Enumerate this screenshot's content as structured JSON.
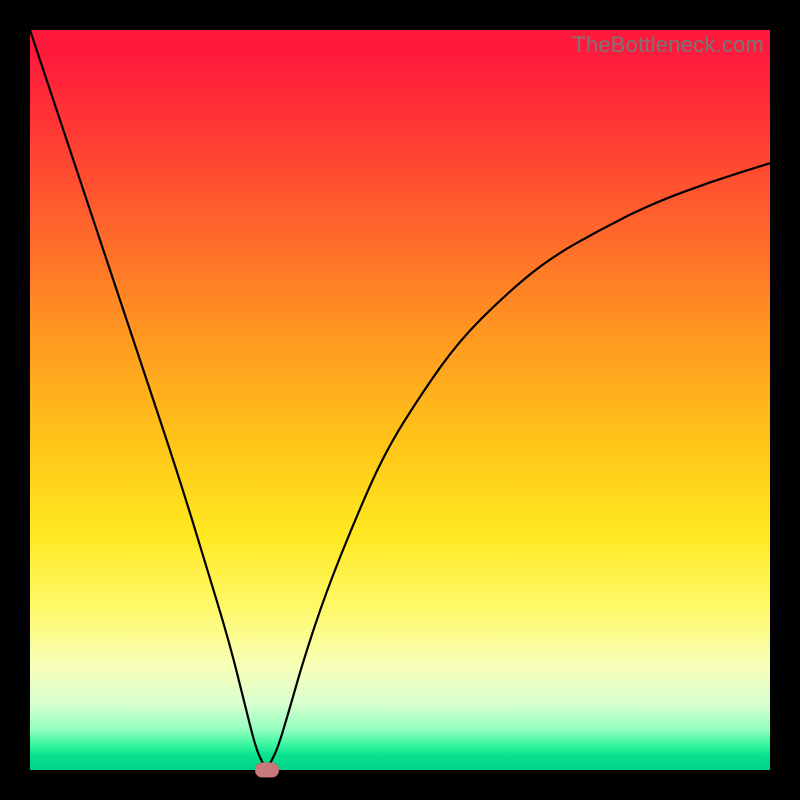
{
  "watermark": "TheBottleneck.com",
  "colors": {
    "page_bg": "#000000",
    "gradient_top": "#ff1a3c",
    "gradient_bottom": "#00d288",
    "curve_stroke": "#000000",
    "marker_fill": "#c77a79"
  },
  "chart_data": {
    "type": "line",
    "title": "",
    "xlabel": "",
    "ylabel": "",
    "xlim": [
      0,
      100
    ],
    "ylim": [
      0,
      100
    ],
    "grid": false,
    "annotations": [
      "TheBottleneck.com"
    ],
    "series": [
      {
        "name": "bottleneck-curve",
        "x": [
          0,
          5,
          10,
          15,
          20,
          24,
          27,
          29,
          30.5,
          31.5,
          32,
          32.5,
          33.5,
          35,
          37,
          40,
          44,
          48,
          53,
          58,
          64,
          70,
          77,
          84,
          92,
          100
        ],
        "values": [
          100,
          85,
          70,
          55,
          40,
          27,
          17,
          9,
          3,
          0.8,
          0,
          1,
          3,
          8,
          15,
          24,
          34,
          43,
          51,
          58,
          64,
          69,
          73,
          76.5,
          79.5,
          82
        ]
      }
    ],
    "marker": {
      "x": 32,
      "y": 0,
      "label": ""
    },
    "notes": "V-shaped curve over a red-to-green vertical gradient; minimum near x≈32%. No numeric axis labels visible."
  }
}
